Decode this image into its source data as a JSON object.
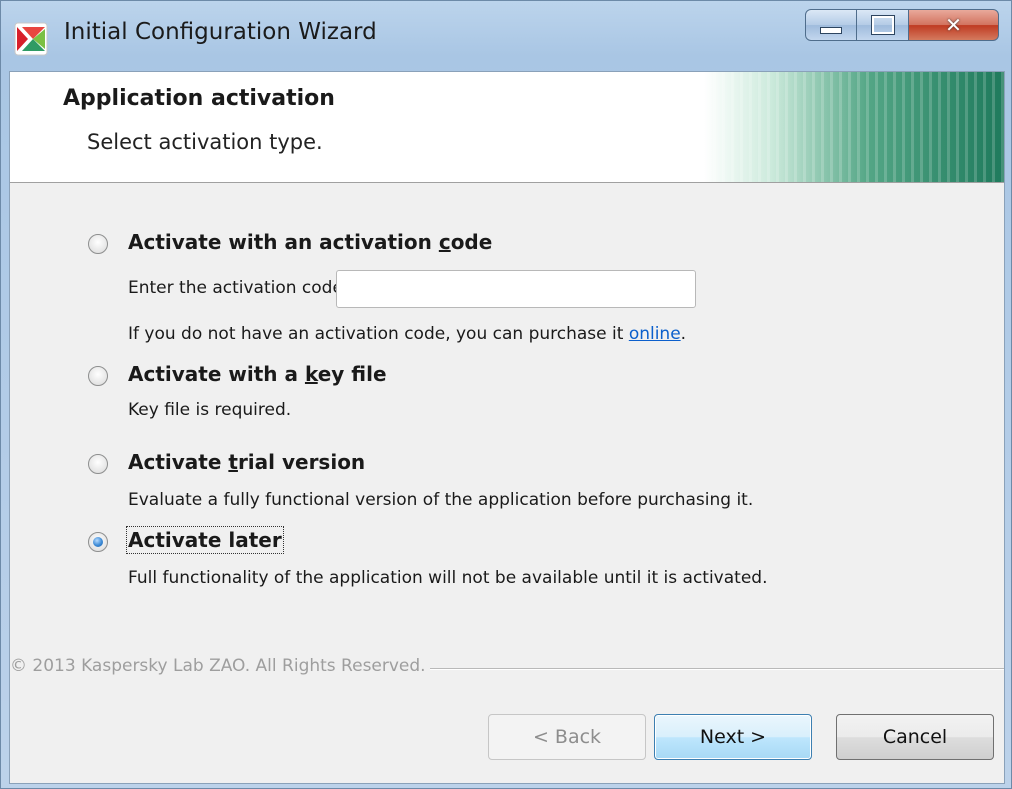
{
  "window": {
    "title": "Initial Configuration Wizard"
  },
  "header": {
    "title": "Application activation",
    "subtitle": "Select activation type."
  },
  "options": [
    {
      "label_pre": "Activate with an activation ",
      "label_key": "c",
      "label_post": "ode",
      "checked": false
    },
    {
      "label_pre": "Activate with a ",
      "label_key": "k",
      "label_post": "ey file",
      "checked": false
    },
    {
      "label_pre": "Activate ",
      "label_key": "t",
      "label_post": "rial version",
      "checked": false
    },
    {
      "label_pre": "Activate later",
      "label_key": "",
      "label_post": "",
      "checked": true
    }
  ],
  "activation_code": {
    "prompt": "Enter the activation code:",
    "value": "",
    "purchase_text": "If you do not have an activation code, you can purchase it ",
    "purchase_link": "online",
    "purchase_end": "."
  },
  "descriptions": {
    "key_file": "Key file is required.",
    "trial": "Evaluate a fully functional version of the application before purchasing it.",
    "later": "Full functionality of the application will not be available until it is activated."
  },
  "footer": {
    "copyright": "© 2013 Kaspersky Lab ZAO. All Rights Reserved.",
    "back_label": "< Back",
    "next_label": "Next >",
    "cancel_label": "Cancel"
  },
  "colors": {
    "accent_green": "#1e7a5c",
    "link": "#0b5fcc",
    "close_red": "#bf3a22"
  }
}
